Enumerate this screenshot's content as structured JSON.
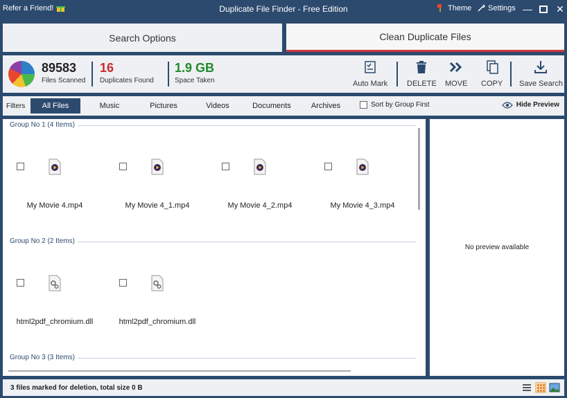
{
  "titlebar": {
    "refer": "Refer a Friend!",
    "title": "Duplicate File Finder - Free Edition",
    "theme": "Theme",
    "settings": "Settings",
    "minimize": "—",
    "close": "✕"
  },
  "tabs": [
    {
      "label": "Search Options"
    },
    {
      "label": "Clean Duplicate Files"
    }
  ],
  "stats": {
    "scanned": {
      "value": "89583",
      "label": "Files Scanned",
      "color": "#222222"
    },
    "duplicates": {
      "value": "16",
      "label": "Duplicates Found",
      "color": "#c62b2b"
    },
    "space": {
      "value": "1.9 GB",
      "label": "Space Taken",
      "color": "#1f8a2a"
    }
  },
  "actions": {
    "automark": "Auto Mark",
    "delete": "DELETE",
    "move": "MOVE",
    "copy": "COPY",
    "save": "Save Search"
  },
  "filters": {
    "label": "Filters",
    "items": [
      "All Files",
      "Music",
      "Pictures",
      "Videos",
      "Documents",
      "Archives"
    ],
    "sort_label": "Sort by Group First",
    "hide_preview": "Hide Preview"
  },
  "groups": [
    {
      "header": "Group No 1 (4 Items)",
      "files": [
        "My Movie 4.mp4",
        "My Movie 4_1.mp4",
        "My Movie 4_2.mp4",
        "My Movie 4_3.mp4"
      ]
    },
    {
      "header": "Group No 2 (2 Items)",
      "files": [
        "html2pdf_chromium.dll",
        "html2pdf_chromium.dll"
      ]
    },
    {
      "header": "Group No 3 (3 Items)",
      "files": []
    }
  ],
  "preview": {
    "text": "No preview available"
  },
  "status": {
    "text": "3 files marked for deletion, total size 0 B"
  },
  "colors": {
    "accent": "#2c4a6e",
    "active_tab_underline": "#d0343a"
  }
}
